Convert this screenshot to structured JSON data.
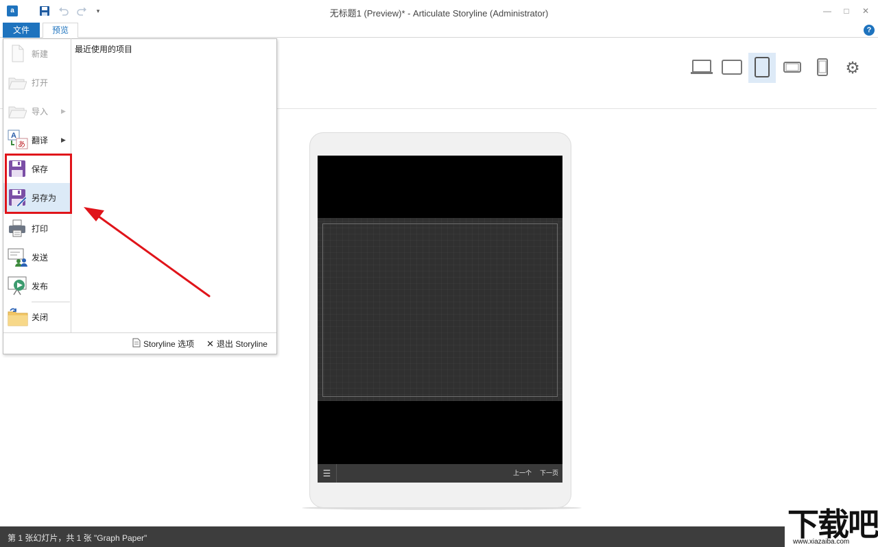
{
  "window": {
    "title": "无标题1 (Preview)* -  Articulate Storyline (Administrator)",
    "minimize_glyph": "—",
    "maximize_glyph": "□",
    "close_glyph": "✕"
  },
  "quick_access": {
    "app_icon": "articulate-logo-icon",
    "save_icon": "save-icon",
    "undo_icon": "undo-icon",
    "redo_icon": "redo-icon",
    "customize_icon": "dropdown-caret-icon"
  },
  "tabs": {
    "file": "文件",
    "preview": "预览",
    "help_glyph": "?"
  },
  "file_menu": {
    "items": [
      {
        "label": "新建",
        "icon": "new-document-icon",
        "enabled": false,
        "submenu": false
      },
      {
        "label": "打开",
        "icon": "open-folder-icon",
        "enabled": false,
        "submenu": false
      },
      {
        "label": "导入",
        "icon": "import-folder-icon",
        "enabled": false,
        "submenu": true
      },
      {
        "label": "翻译",
        "icon": "translate-icon",
        "enabled": true,
        "submenu": true
      },
      {
        "label": "保存",
        "icon": "floppy-save-icon",
        "enabled": true,
        "submenu": false
      },
      {
        "label": "另存为",
        "icon": "floppy-save-as-icon",
        "enabled": true,
        "submenu": false
      },
      {
        "label": "打印",
        "icon": "printer-icon",
        "enabled": true,
        "submenu": false
      },
      {
        "label": "发送",
        "icon": "send-people-icon",
        "enabled": true,
        "submenu": false
      },
      {
        "label": "发布",
        "icon": "publish-play-icon",
        "enabled": true,
        "submenu": false
      },
      {
        "label": "关闭",
        "icon": "close-folder-icon",
        "enabled": true,
        "submenu": false
      }
    ],
    "submenu_arrow": "▶",
    "recent_heading": "最近使用的项目",
    "options_label": "Storyline 选项",
    "exit_label": "退出 Storyline",
    "exit_glyph": "✕"
  },
  "device_toolbar": {
    "devices": [
      {
        "name": "desktop",
        "icon": "laptop-icon",
        "active": false
      },
      {
        "name": "tablet-landscape",
        "icon": "tablet-landscape-icon",
        "active": false
      },
      {
        "name": "tablet-portrait",
        "icon": "tablet-portrait-icon",
        "active": true
      },
      {
        "name": "phone-landscape",
        "icon": "phone-landscape-icon",
        "active": false
      },
      {
        "name": "phone-portrait",
        "icon": "phone-portrait-icon",
        "active": false
      }
    ],
    "settings_icon": "gear-icon",
    "settings_glyph": "⚙"
  },
  "player": {
    "menu_glyph": "☰",
    "prev_label": "上一个",
    "next_label": "下一页"
  },
  "status_bar": {
    "text": "第 1 张幻灯片，共 1 张    \"Graph Paper\""
  },
  "annotation": {
    "color": "#e0141a"
  },
  "watermark": {
    "main": "下载吧",
    "url": "www.xiazaiba.com"
  }
}
